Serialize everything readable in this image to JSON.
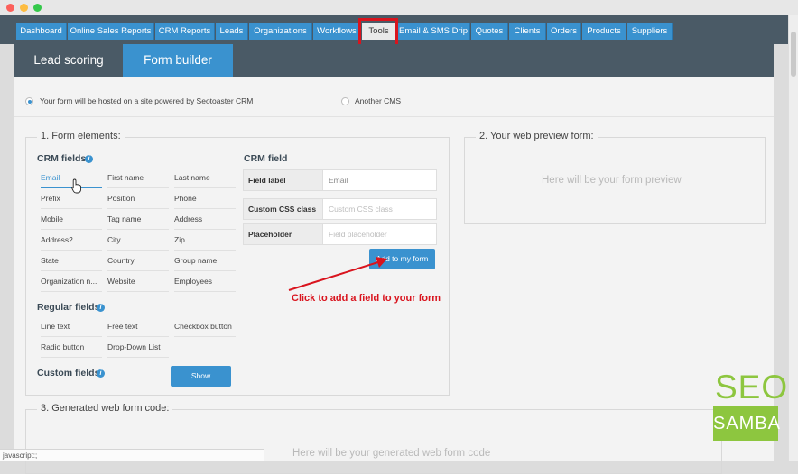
{
  "window": {
    "controls": [
      "close",
      "minimize",
      "maximize"
    ],
    "colors": {
      "close": "#fc605b",
      "minimize": "#fdbc40",
      "maximize": "#34c84a"
    }
  },
  "nav": {
    "tabs": [
      {
        "label": "Dashboard",
        "active": false
      },
      {
        "label": "Online Sales Reports",
        "active": false
      },
      {
        "label": "CRM Reports",
        "active": false
      },
      {
        "label": "Leads",
        "active": false
      },
      {
        "label": "Organizations",
        "active": false
      },
      {
        "label": "Workflows",
        "active": false
      },
      {
        "label": "Tools",
        "active": true
      },
      {
        "label": "Email & SMS Drip",
        "active": false
      },
      {
        "label": "Quotes",
        "active": false
      },
      {
        "label": "Clients",
        "active": false
      },
      {
        "label": "Orders",
        "active": false
      },
      {
        "label": "Products",
        "active": false
      },
      {
        "label": "Suppliers",
        "active": false
      }
    ]
  },
  "subnav": {
    "tabs": [
      {
        "label": "Lead scoring",
        "active": false
      },
      {
        "label": "Form builder",
        "active": true
      }
    ]
  },
  "hosting": {
    "option_seotoaster": "Your form will be hosted on a site powered by Seotoaster CRM",
    "option_other": "Another CMS",
    "selected": "option_seotoaster"
  },
  "form_elements": {
    "legend": "1. Form elements:",
    "crm_fields_title": "CRM fields",
    "crm_fields": [
      "Email",
      "First name",
      "Last name",
      "Prefix",
      "Position",
      "Phone",
      "Mobile",
      "Tag name",
      "Address",
      "Address2",
      "City",
      "Zip",
      "State",
      "Country",
      "Group name",
      "Organization n...",
      "Website",
      "Employees"
    ],
    "active_field": "Email",
    "regular_fields_title": "Regular fields",
    "regular_fields": [
      "Line text",
      "Free text",
      "Checkbox button",
      "Radio button",
      "Drop-Down List"
    ],
    "custom_fields_title": "Custom fields",
    "show_button": "Show",
    "info_icon": "i",
    "crm_field_title": "CRM field",
    "field_label_label": "Field label",
    "field_label_value": "Email",
    "css_class_label": "Custom CSS class",
    "css_class_placeholder": "Custom CSS class",
    "placeholder_label": "Placeholder",
    "placeholder_placeholder": "Field placeholder",
    "add_button": "Add to my form"
  },
  "preview": {
    "legend": "2. Your web preview form:",
    "placeholder": "Here will be your form preview"
  },
  "generated": {
    "legend": "3. Generated web form code:",
    "placeholder": "Here will be your generated web form code"
  },
  "annotation": {
    "text": "Click to add a field to your form",
    "color": "#d9141e"
  },
  "logo": {
    "top": "SEO",
    "bottom": "SAMBA",
    "color": "#8dc63f"
  },
  "status_bar": "javascript:;",
  "colors": {
    "accent": "#3a92cf",
    "nav_bg": "#4a5a66",
    "highlight": "#d9141e"
  }
}
